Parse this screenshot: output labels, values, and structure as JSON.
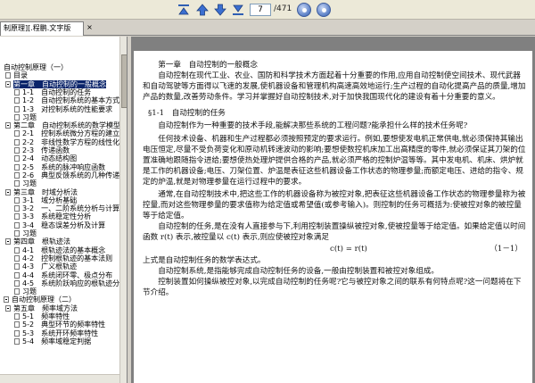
{
  "toolbar": {
    "page_current": "7",
    "page_total": "/471",
    "buttons": [
      "first-page-icon",
      "previous-page-icon",
      "next-page-icon",
      "last-page-icon",
      "go-icon",
      "refresh-icon"
    ]
  },
  "tab": {
    "label": "制原理][.程鹏.文字版",
    "close": "×"
  },
  "sidebar": {
    "items": [
      {
        "label": "自动控制原理（一）",
        "level": 0,
        "icon": "none"
      },
      {
        "label": "目录",
        "level": 1,
        "icon": "page"
      },
      {
        "label": "第一章　自动控制的一般概念",
        "level": 1,
        "icon": "minus",
        "selected": true
      },
      {
        "label": "1-1　自动控制的任务",
        "level": 2,
        "icon": "page"
      },
      {
        "label": "1-2　自动控制系统的基本方式",
        "level": 2,
        "icon": "page"
      },
      {
        "label": "1-3　对控制系统的性能要求",
        "level": 2,
        "icon": "page"
      },
      {
        "label": "习题",
        "level": 2,
        "icon": "page"
      },
      {
        "label": "第二章　自动控制系统的数学模型",
        "level": 1,
        "icon": "minus"
      },
      {
        "label": "2-1　控制系统微分方程的建立",
        "level": 2,
        "icon": "page"
      },
      {
        "label": "2-2　非线性数学方程的线性化",
        "level": 2,
        "icon": "page"
      },
      {
        "label": "2-3　传递函数",
        "level": 2,
        "icon": "page"
      },
      {
        "label": "2-4　动态结构图",
        "level": 2,
        "icon": "page"
      },
      {
        "label": "2-5　系统的脉冲响应函数",
        "level": 2,
        "icon": "page"
      },
      {
        "label": "2-6　典型反馈系统的几种传递函数",
        "level": 2,
        "icon": "page"
      },
      {
        "label": "习题",
        "level": 2,
        "icon": "page"
      },
      {
        "label": "第三章　时域分析法",
        "level": 1,
        "icon": "minus"
      },
      {
        "label": "3-1　域分析基础",
        "level": 2,
        "icon": "page"
      },
      {
        "label": "3-2　一、二阶系统分析与计算",
        "level": 2,
        "icon": "page"
      },
      {
        "label": "3-3　系统稳定性分析",
        "level": 2,
        "icon": "page"
      },
      {
        "label": "3-4　稳态误差分析及计算",
        "level": 2,
        "icon": "page"
      },
      {
        "label": "习题",
        "level": 2,
        "icon": "page"
      },
      {
        "label": "第四章　根轨迹法",
        "level": 1,
        "icon": "minus"
      },
      {
        "label": "4-1　根轨迹法的基本概念",
        "level": 2,
        "icon": "page"
      },
      {
        "label": "4-2　控制根轨迹的基本法则",
        "level": 2,
        "icon": "page"
      },
      {
        "label": "4-3　广义根轨迹",
        "level": 2,
        "icon": "page"
      },
      {
        "label": "4-4　系统闭环零、极点分布",
        "level": 2,
        "icon": "page"
      },
      {
        "label": "4-5　系统阶跃响应的根轨迹分析",
        "level": 2,
        "icon": "page"
      },
      {
        "label": "习题",
        "level": 2,
        "icon": "page"
      },
      {
        "label": "自动控制原理（二）",
        "level": 0,
        "icon": "minus"
      },
      {
        "label": "第五章　频率域方法",
        "level": 1,
        "icon": "minus"
      },
      {
        "label": "5-1　频率特性",
        "level": 2,
        "icon": "page"
      },
      {
        "label": "5-2　典型环节的频率特性",
        "level": 2,
        "icon": "page"
      },
      {
        "label": "5-3　系统开环频率特性",
        "level": 2,
        "icon": "page"
      },
      {
        "label": "5-4　频率域稳定判据",
        "level": 2,
        "icon": "page"
      }
    ]
  },
  "document": {
    "chapter_heading": "第一章　自动控制的一般概念",
    "para1": "自动控制在现代工业、农业、国防和科学技术方面起着十分重要的作用,应用自动控制使空间技术、现代武器和自动驾驶等方面得以飞速的发展,使机器设备和管理机构高速高效地运行;生产过程的自动化提高产品的质量,增加产品的数量,改善劳动条件。学习并掌握好自动控制技术,对于加快我国现代化的建设有着十分重要的意义。",
    "section_heading": "§1-1　自动控制的任务",
    "para2": "自动控制作为一种重要的技术手段,能解决那些系统的工程问题?能承担什么样的技术任务呢?",
    "para3": "任何技术设备、机器和生产过程都必须按照预定的要求运行。例如,要想使发电机正常供电,就必须保持其输出电压恒定,尽量不受负荷变化和原动机转速波动的影响;要想使数控机床加工出高精度的零件,就必须保证其刀架的位置准确地跟随指令进给;要想使热处理炉提供合格的产品,就必须严格的控制炉温等等。其中发电机、机床、烘炉就是工作的机器设备;电压、刀架位置、炉温是表征这些机器设备工作状态的物理参量;而额定电压、进给的指令、规定的炉温,就是对物理参量在运行过程中的要求。",
    "para4": "通常,在自动控制技术中,把这些工作的机器设备称为被控对象,把表征这些机器设备工作状态的物理参量称为被控量,而对这些物理参量的要求值称为给定值或希望值(或参考输入)。则控制的任务可概括为:使被控对象的被控量等于给定值。",
    "para5": "自动控制的任务,是在没有人直接参与下,利用控制装置操纵被控对象,使被控量等于给定值。如果给定值以时间函数 r(t) 表示,被控量以 c(t) 表示,则应使被控对象满足",
    "formula": "c(t) = r(t)",
    "equation_number": "（1－1）",
    "para6": "上式是自动控制任务的数学表达式。",
    "para7": "自动控制系统,是指能够完成自动控制任务的设备,一般由控制装置和被控对象组成。",
    "para8": "控制装置如何操纵被控对象,以完成自动控制的任务呢?它与被控对象之间的联系有何特点呢?这一问题将在下节介绍。"
  }
}
